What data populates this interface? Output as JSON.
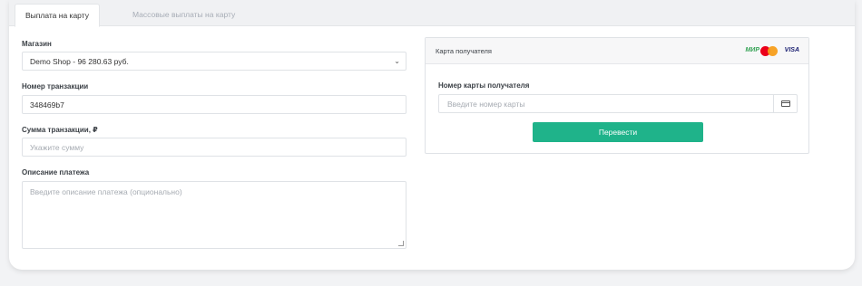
{
  "tabs": [
    {
      "label": "Выплата на карту",
      "active": true
    },
    {
      "label": "Массовые выплаты на карту",
      "active": false
    }
  ],
  "form": {
    "shop": {
      "label": "Магазин",
      "value": "Demo Shop - 96 280.63 руб."
    },
    "transaction_number": {
      "label": "Номер транзакции",
      "value": "348469b7"
    },
    "amount": {
      "label": "Сумма транзакции, ₽",
      "placeholder": "Укажите сумму"
    },
    "description": {
      "label": "Описание платежа",
      "placeholder": "Введите описание платежа (опционально)"
    }
  },
  "recipient": {
    "title": "Карта получателя",
    "brands": {
      "mir": "МИР",
      "visa": "VISA"
    },
    "card_label": "Номер карты получателя",
    "card_placeholder": "Введите номер карты",
    "submit_label": "Перевести"
  },
  "colors": {
    "accent": "#1fb38a",
    "mir": "#36a356",
    "visa": "#1a1f71",
    "mastercard_red": "#eb001b",
    "mastercard_orange": "#f79e1b"
  },
  "icons": {
    "select_chevron": "chevron-down-icon",
    "card_field": "credit-card-icon",
    "textarea_grip": "resize-grip-icon"
  }
}
